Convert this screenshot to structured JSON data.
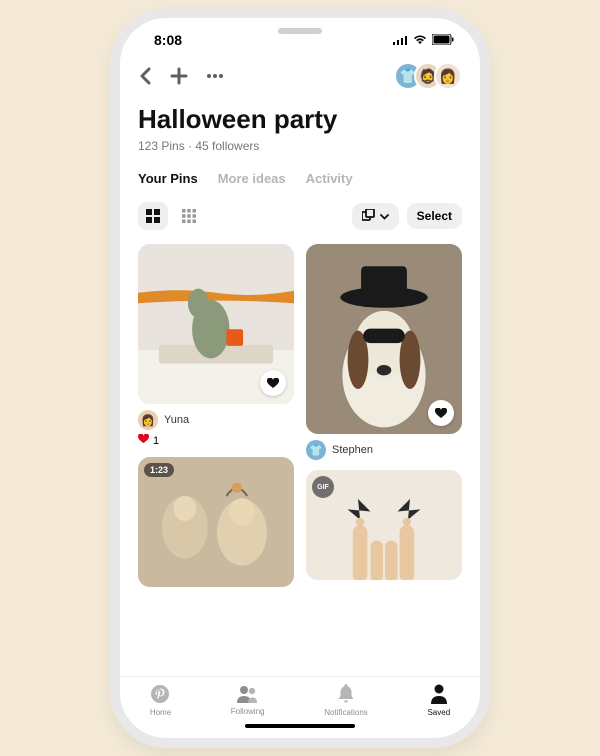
{
  "statusBar": {
    "time": "8:08"
  },
  "board": {
    "title": "Halloween party",
    "subtitle": "123 Pins · 45 followers"
  },
  "collaborators": {
    "a1": "👕",
    "a2": "🧔",
    "a3": "👩"
  },
  "tabs": {
    "t0": "Your Pins",
    "t1": "More ideas",
    "t2": "Activity"
  },
  "controls": {
    "selectLabel": "Select"
  },
  "pins": {
    "p1": {
      "height": 160,
      "author": "Yuna",
      "avatar": "👩",
      "likes": "1"
    },
    "p2": {
      "height": 190,
      "author": "Stephen",
      "avatar": "👕"
    },
    "p3": {
      "height": 130,
      "badge": "1:23"
    },
    "p4": {
      "height": 110,
      "badge": "GIF"
    }
  },
  "navBar": {
    "n0": "Home",
    "n1": "Following",
    "n2": "Notifications",
    "n3": "Saved"
  }
}
